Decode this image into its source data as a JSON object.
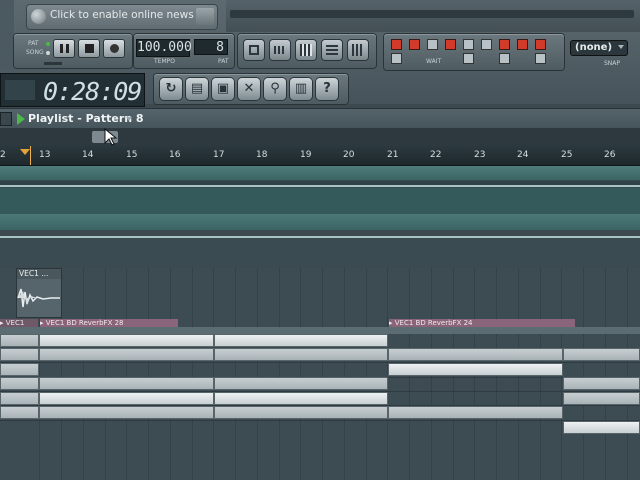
{
  "toolbar": {
    "news_text": "Click to enable online news",
    "pat_label": "PAT",
    "song_label": "SONG",
    "tempo_value": "100.000",
    "tempo_label": "TEMPO",
    "pattern_value": "8",
    "pattern_label": "PAT",
    "time_value": "0:28:09",
    "wait_label": "WAIT",
    "snap_value": "(none)",
    "snap_label": "SNAP"
  },
  "playlist": {
    "title": "Playlist - Pattern 8",
    "ruler_ticks": [
      "2",
      "13",
      "14",
      "15",
      "16",
      "17",
      "18",
      "19",
      "20",
      "21",
      "22",
      "23",
      "24",
      "25",
      "26"
    ],
    "sample_clip": "VEC1 ...",
    "pattern_clips": [
      {
        "label": "VEC1"
      },
      {
        "label": "VEC1 BD ReverbFX 28"
      },
      {
        "label": "VEC1 BD ReverbFX 24"
      }
    ]
  },
  "colors": {
    "accent_green": "#4cb848",
    "record_red": "#d23a2a",
    "automation_teal": "#3f6a6a",
    "clip_purple": "#8a6478"
  }
}
